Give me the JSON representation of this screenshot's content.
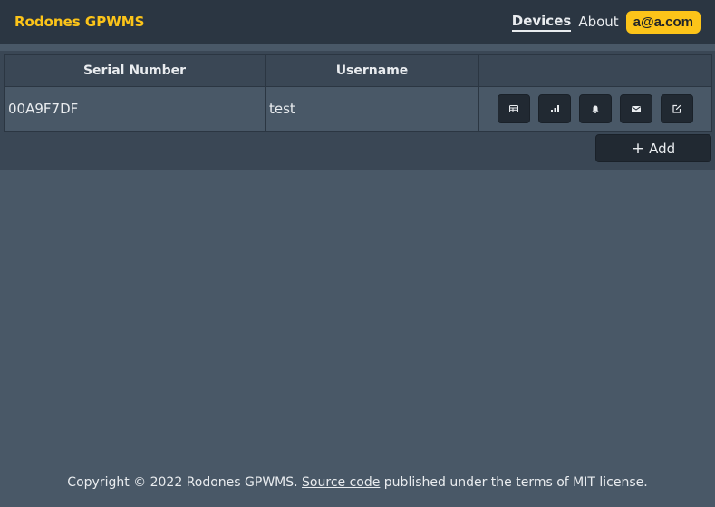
{
  "navbar": {
    "brand": "Rodones GPWMS",
    "links": [
      {
        "label": "Devices",
        "active": true
      },
      {
        "label": "About",
        "active": false
      }
    ],
    "user": "a@a.com"
  },
  "table": {
    "columns": [
      "Serial Number",
      "Username",
      ""
    ],
    "rows": [
      {
        "serial": "00A9F7DF",
        "username": "test",
        "actions": [
          "table-icon",
          "signal-bars-icon",
          "bell-icon",
          "envelope-icon",
          "edit-icon"
        ]
      }
    ]
  },
  "add_button": "Add",
  "footer": {
    "prefix": "Copyright © 2022 Rodones GPWMS.",
    "link": "Source code",
    "suffix": "published under the terms of MIT license."
  },
  "colors": {
    "accent": "#fcc419",
    "navbar": "#2b3642",
    "background": "#495867"
  }
}
